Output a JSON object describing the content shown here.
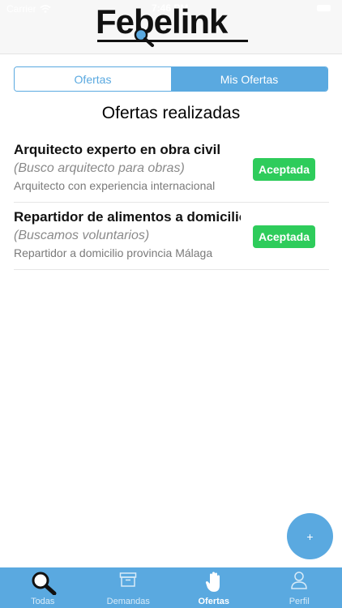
{
  "status_bar": {
    "carrier": "Carrier",
    "time": "7:46 PM"
  },
  "header": {
    "logo_text": "Febelink"
  },
  "segmented": {
    "tabs": [
      "Ofertas",
      "Mis Ofertas"
    ],
    "selected": "Mis Ofertas"
  },
  "main": {
    "title": "Ofertas realizadas",
    "items": [
      {
        "title": "Arquitecto experto en obra civil",
        "subtitle": "(Busco arquitecto para obras)",
        "description": "Arquitecto con experiencia internacional",
        "status": "Aceptada"
      },
      {
        "title": "Repartidor de alimentos a domicilio",
        "subtitle": "(Buscamos voluntarios)",
        "description": "Repartidor a domicilio provincia Málaga",
        "status": "Aceptada"
      }
    ]
  },
  "fab": {
    "label": "+"
  },
  "tabbar": {
    "items": [
      {
        "label": "Todas",
        "icon": "magnifier-icon"
      },
      {
        "label": "Demandas",
        "icon": "archive-box-icon"
      },
      {
        "label": "Ofertas",
        "icon": "hand-icon"
      },
      {
        "label": "Perfil",
        "icon": "person-icon"
      }
    ],
    "active": "Ofertas"
  },
  "colors": {
    "accent": "#5aa9e0",
    "badge": "#2ecc5b",
    "header_bg": "#f7f7f7"
  }
}
